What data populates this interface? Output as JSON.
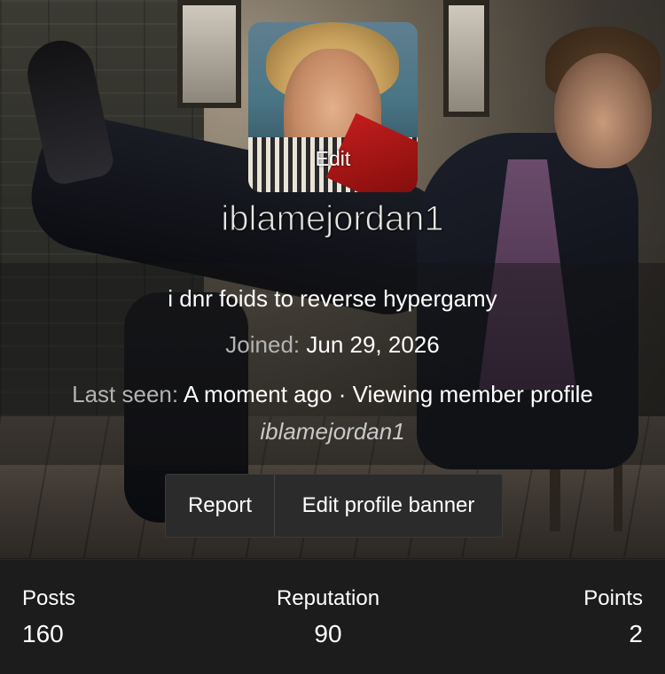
{
  "profile": {
    "username": "iblamejordan1",
    "avatar_edit_label": "Edit",
    "about": "i dnr foids to reverse hypergamy",
    "joined_label": "Joined:",
    "joined_date": "Jun 29, 2026",
    "last_seen_label": "Last seen:",
    "last_seen_value": "A moment ago · Viewing member profile",
    "last_seen_target": "iblamejordan1"
  },
  "actions": {
    "report_label": "Report",
    "edit_banner_label": "Edit profile banner"
  },
  "stats": [
    {
      "label": "Posts",
      "value": "160"
    },
    {
      "label": "Reputation",
      "value": "90"
    },
    {
      "label": "Points",
      "value": "2"
    }
  ],
  "colors": {
    "background": "#1d1d1d",
    "text": "#ffffff",
    "muted_text": "#b3b3b3",
    "button_bg": "#2b2b2b"
  }
}
